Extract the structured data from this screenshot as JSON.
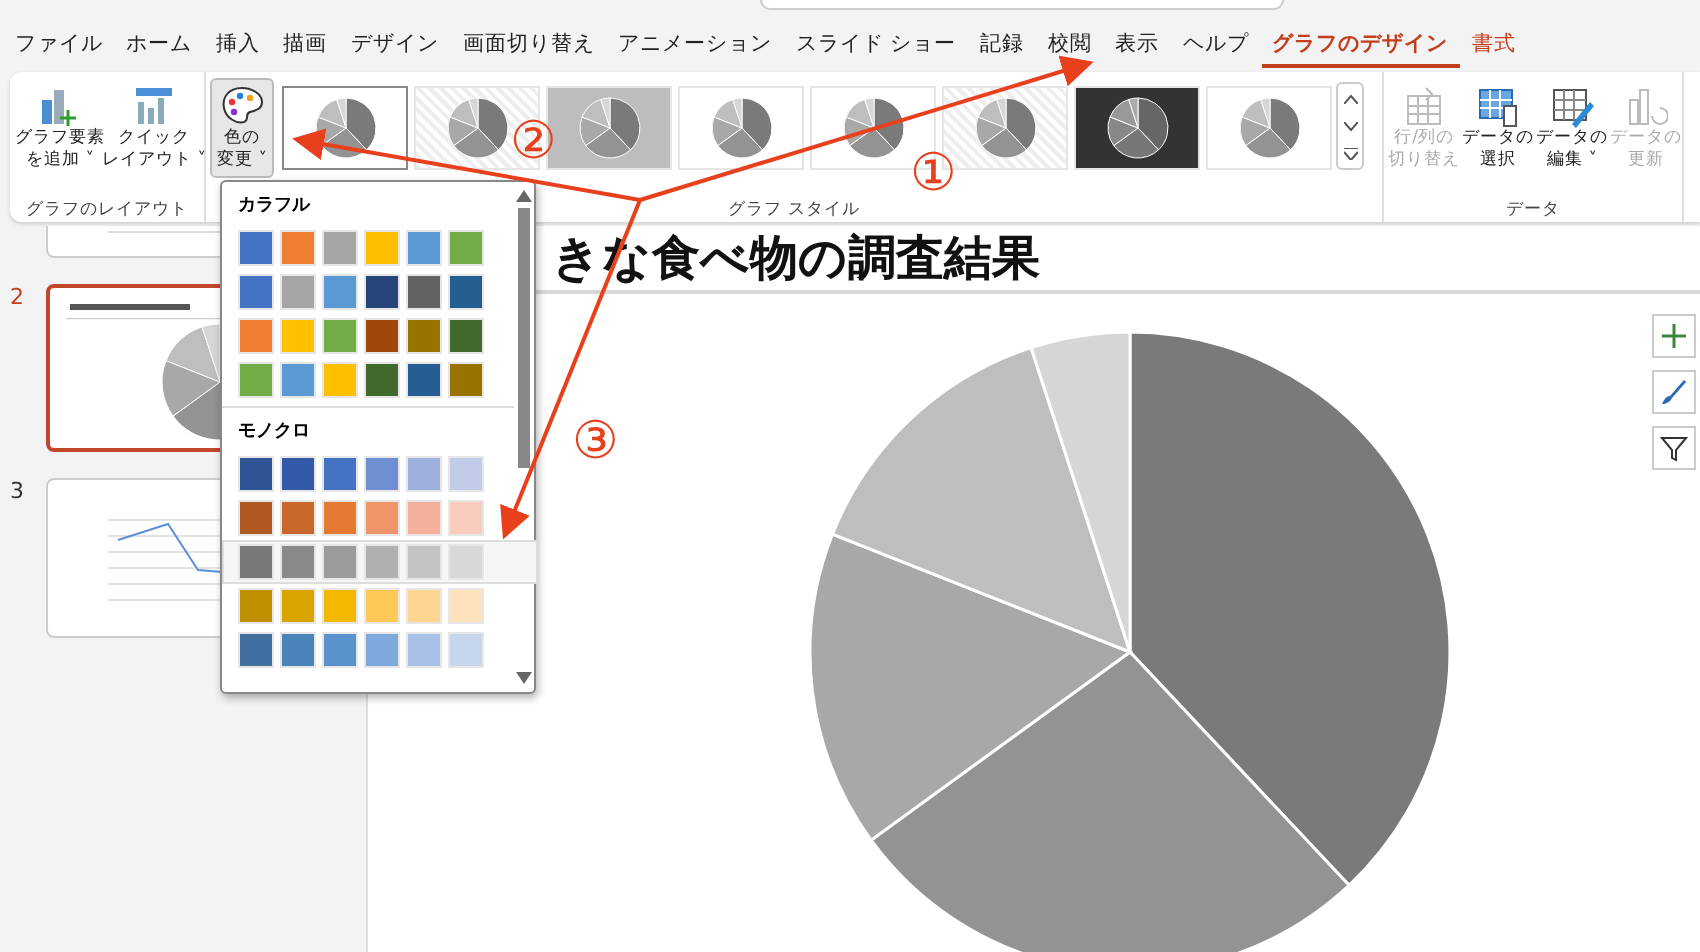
{
  "tabs": [
    {
      "label": "ファイル",
      "selected": false,
      "kind": "normal"
    },
    {
      "label": "ホーム",
      "selected": false,
      "kind": "normal"
    },
    {
      "label": "挿入",
      "selected": false,
      "kind": "normal"
    },
    {
      "label": "描画",
      "selected": false,
      "kind": "normal"
    },
    {
      "label": "デザイン",
      "selected": false,
      "kind": "normal"
    },
    {
      "label": "画面切り替え",
      "selected": false,
      "kind": "normal"
    },
    {
      "label": "アニメーション",
      "selected": false,
      "kind": "normal"
    },
    {
      "label": "スライド ショー",
      "selected": false,
      "kind": "normal"
    },
    {
      "label": "記録",
      "selected": false,
      "kind": "normal"
    },
    {
      "label": "校閲",
      "selected": false,
      "kind": "normal"
    },
    {
      "label": "表示",
      "selected": false,
      "kind": "normal"
    },
    {
      "label": "ヘルプ",
      "selected": false,
      "kind": "normal"
    },
    {
      "label": "グラフのデザイン",
      "selected": true,
      "kind": "contextual"
    },
    {
      "label": "書式",
      "selected": false,
      "kind": "contextual"
    }
  ],
  "ribbon": {
    "layout_group": {
      "label": "グラフのレイアウト",
      "buttons": [
        {
          "lines": [
            "グラフ要素",
            "を追加 ˅"
          ],
          "kind": "add-element"
        },
        {
          "lines": [
            "クイック",
            "レイアウト ˅"
          ],
          "kind": "quick-layout"
        }
      ]
    },
    "color_button": {
      "lines": [
        "色の",
        "変更 ˅"
      ],
      "pressed": true
    },
    "style_group": {
      "label": "グラフ スタイル",
      "styles": [
        {
          "kind": "plain",
          "selected": true
        },
        {
          "kind": "striped",
          "selected": false
        },
        {
          "kind": "shaded",
          "selected": false
        },
        {
          "kind": "plain",
          "selected": false
        },
        {
          "kind": "plain",
          "selected": false
        },
        {
          "kind": "striped",
          "selected": false
        },
        {
          "kind": "dark",
          "selected": false
        },
        {
          "kind": "plain",
          "selected": false
        }
      ]
    },
    "data_group": {
      "label": "データ",
      "buttons": [
        {
          "lines": [
            "行/列の",
            "切り替え"
          ],
          "kind": "switch",
          "disabled": true
        },
        {
          "lines": [
            "データの",
            "選択"
          ],
          "kind": "select",
          "disabled": false
        },
        {
          "lines": [
            "データの",
            "編集 ˅"
          ],
          "kind": "edit",
          "disabled": false
        },
        {
          "lines": [
            "データの",
            "更新"
          ],
          "kind": "refresh",
          "disabled": true
        }
      ]
    }
  },
  "palette": {
    "sections": [
      {
        "title": "カラフル",
        "rows": [
          {
            "selected": false,
            "swatches": [
              {
                "color": "#4472c4"
              },
              {
                "color": "#ed7d31"
              },
              {
                "color": "#a5a5a5"
              },
              {
                "color": "#ffc000"
              },
              {
                "color": "#5b9bd5"
              },
              {
                "color": "#70ad47"
              }
            ]
          },
          {
            "selected": false,
            "swatches": [
              {
                "color": "#4472c4"
              },
              {
                "color": "#a5a5a5"
              },
              {
                "color": "#5b9bd5"
              },
              {
                "color": "#264478"
              },
              {
                "color": "#636363"
              },
              {
                "color": "#255e91"
              }
            ]
          },
          {
            "selected": false,
            "swatches": [
              {
                "color": "#ed7d31"
              },
              {
                "color": "#ffc000"
              },
              {
                "color": "#70ad47"
              },
              {
                "color": "#9e480e"
              },
              {
                "color": "#997300"
              },
              {
                "color": "#43682b"
              }
            ]
          },
          {
            "selected": false,
            "swatches": [
              {
                "color": "#70ad47"
              },
              {
                "color": "#5b9bd5"
              },
              {
                "color": "#ffc000"
              },
              {
                "color": "#43682b"
              },
              {
                "color": "#255e91"
              },
              {
                "color": "#997300"
              }
            ]
          }
        ]
      },
      {
        "title": "モノクロ",
        "rows": [
          {
            "selected": false,
            "swatches": [
              {
                "color": "#2f5597"
              },
              {
                "color": "#335aa8"
              },
              {
                "color": "#4472c4"
              },
              {
                "color": "#6f8ed1"
              },
              {
                "color": "#9cb0db"
              },
              {
                "color": "#c0cce8"
              }
            ]
          },
          {
            "selected": false,
            "swatches": [
              {
                "color": "#ae5a21"
              },
              {
                "color": "#c9672a"
              },
              {
                "color": "#e57b32"
              },
              {
                "color": "#f0956a"
              },
              {
                "color": "#f4b09a"
              },
              {
                "color": "#f8cbbd"
              }
            ]
          },
          {
            "selected": true,
            "swatches": [
              {
                "color": "#787878"
              },
              {
                "color": "#8a8a8a"
              },
              {
                "color": "#9c9c9c"
              },
              {
                "color": "#b0b0b0"
              },
              {
                "color": "#c4c4c4"
              },
              {
                "color": "#d8d8d8"
              }
            ]
          },
          {
            "selected": false,
            "swatches": [
              {
                "color": "#bf8f00"
              },
              {
                "color": "#d9a300"
              },
              {
                "color": "#f5b800"
              },
              {
                "color": "#ffc857"
              },
              {
                "color": "#ffd592"
              },
              {
                "color": "#ffe3bc"
              }
            ]
          },
          {
            "selected": false,
            "swatches": [
              {
                "color": "#416f9f"
              },
              {
                "color": "#4a82ba"
              },
              {
                "color": "#5892cc"
              },
              {
                "color": "#7fa8dc"
              },
              {
                "color": "#a6c1e5"
              },
              {
                "color": "#c4d5ec"
              }
            ]
          }
        ]
      }
    ]
  },
  "slides": [
    {
      "selected": false,
      "kind": "partial"
    },
    {
      "number": "2",
      "selected": true,
      "kind": "pie"
    },
    {
      "number": "3",
      "selected": false,
      "kind": "line"
    }
  ],
  "slide": {
    "title": "きな食べ物の調査結果"
  },
  "annotations": [
    {
      "label": "①"
    },
    {
      "label": "②"
    },
    {
      "label": "③"
    }
  ]
}
